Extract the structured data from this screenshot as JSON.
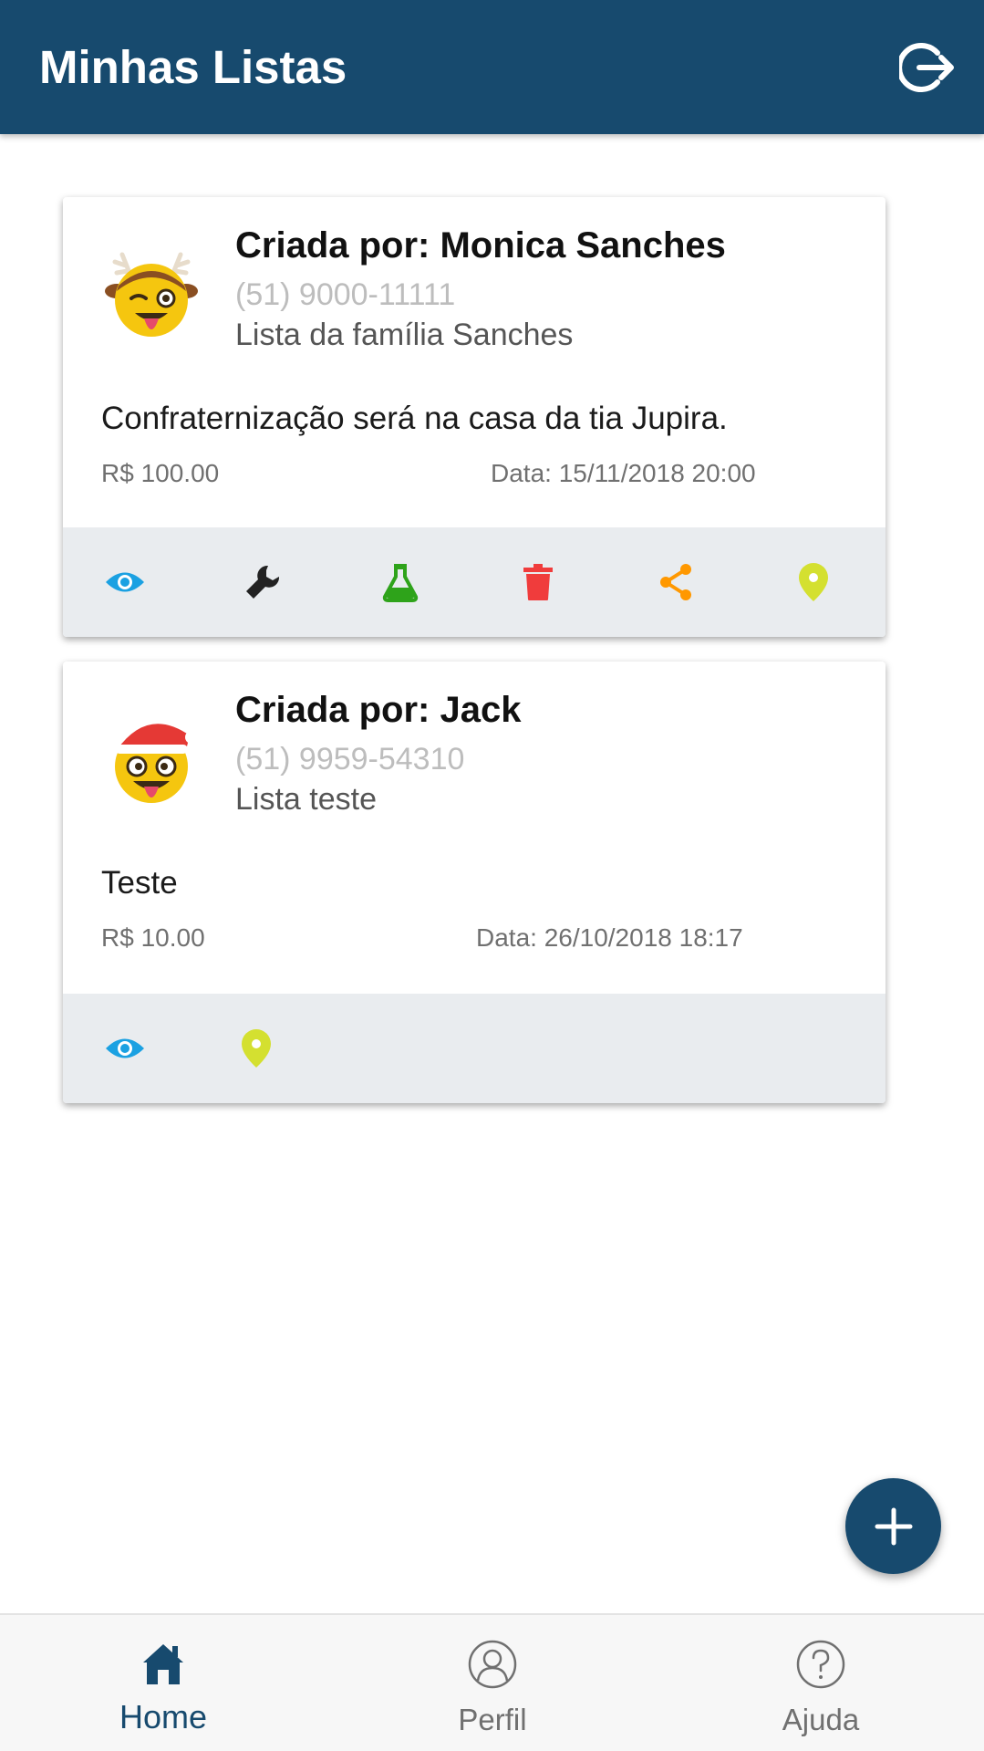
{
  "app_bar": {
    "title": "Minhas Listas",
    "logout_icon": "logout-icon"
  },
  "lists": [
    {
      "avatar_icon": "reindeer-emoji-avatar",
      "creator": "Criada por: Monica Sanches",
      "phone": "(51) 9000-11111",
      "name": "Lista da família Sanches",
      "description": "Confraternização será na casa da tia Jupira.",
      "price": "R$ 100.00",
      "date": "Data: 15/11/2018 20:00",
      "actions": [
        "eye-icon",
        "wrench-icon",
        "flask-icon",
        "trash-icon",
        "share-icon",
        "map-pin-icon"
      ]
    },
    {
      "avatar_icon": "santa-hat-emoji-avatar",
      "creator": "Criada por: Jack",
      "phone": "(51) 9959-54310",
      "name": "Lista teste",
      "description": "Teste",
      "price": "R$ 10.00",
      "date": "Data: 26/10/2018 18:17",
      "actions": [
        "eye-icon",
        "map-pin-icon"
      ]
    }
  ],
  "fab": {
    "icon": "plus-icon"
  },
  "bottom_nav": [
    {
      "label": "Home",
      "icon": "home-icon",
      "active": true
    },
    {
      "label": "Perfil",
      "icon": "user-icon",
      "active": false
    },
    {
      "label": "Ajuda",
      "icon": "help-icon",
      "active": false
    }
  ],
  "colors": {
    "primary": "#174a6e",
    "view": "#1ba1e2",
    "edit": "#222222",
    "test": "#2ea31a",
    "delete": "#f03c3c",
    "share": "#ff9800",
    "location": "#d4e030"
  }
}
